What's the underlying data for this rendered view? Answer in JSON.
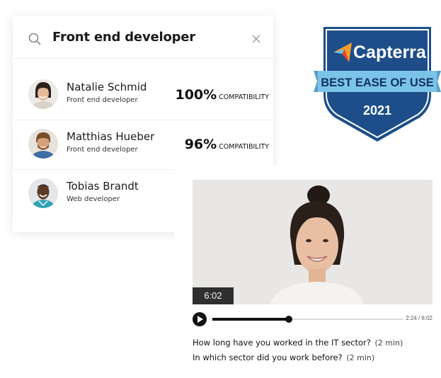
{
  "search": {
    "value": "Front end developer"
  },
  "candidates": [
    {
      "name": "Natalie Schmid",
      "role": "Front end developer",
      "compatibility_pct": "100%",
      "compatibility_label": "COMPATIBILITY"
    },
    {
      "name": "Matthias Hueber",
      "role": "Front end developer",
      "compatibility_pct": "96%",
      "compatibility_label": "COMPATIBILITY"
    },
    {
      "name": "Tobias Brandt",
      "role": "Web developer"
    }
  ],
  "badge": {
    "brand": "Capterra",
    "award": "BEST EASE OF USE",
    "year": "2021",
    "colors": {
      "shield": "#1d4e89",
      "ribbon": "#7cc3e9",
      "flag": "#ff9d28"
    }
  },
  "video": {
    "duration": "6:02",
    "time_readout": "2:24 / 6:02",
    "progress": 0.4,
    "questions": [
      {
        "text": "How long have you worked in the IT sector?",
        "duration": "(2 min)"
      },
      {
        "text": "In which sector did you work before?",
        "duration": "(2 min)"
      }
    ]
  },
  "icons": {
    "search": "search-icon",
    "clear": "close-icon",
    "play": "play-icon"
  }
}
